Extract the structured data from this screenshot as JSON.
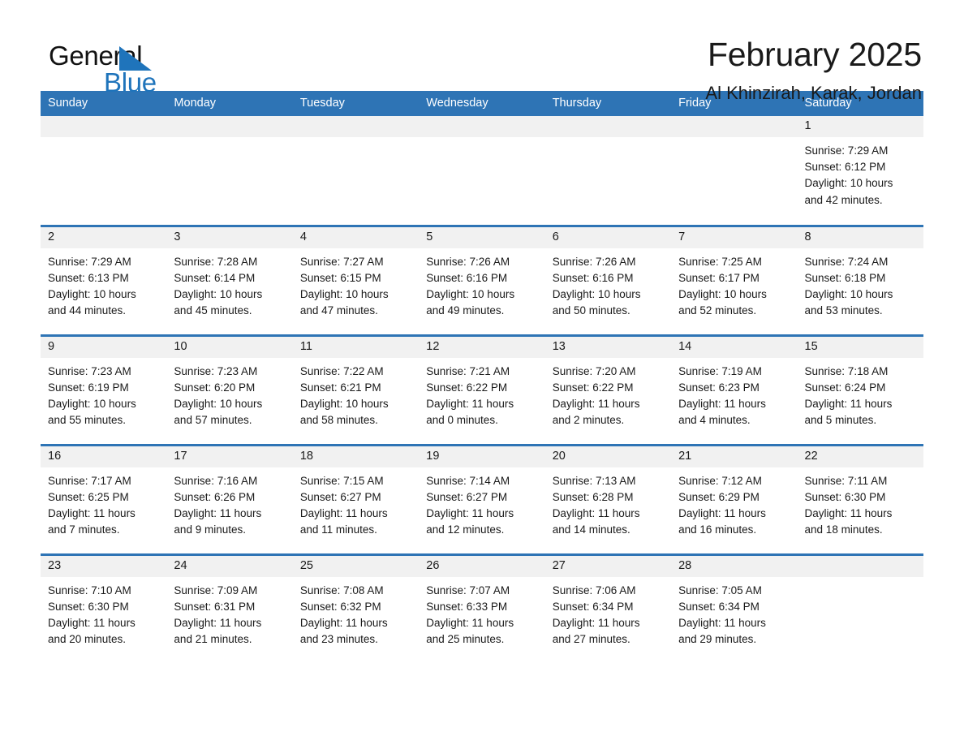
{
  "logo": {
    "text_primary": "General",
    "text_secondary": "Blue",
    "accent_color": "#1f74bb"
  },
  "header": {
    "title": "February 2025",
    "subtitle": "Al Khinzirah, Karak, Jordan",
    "header_bar_color": "#2e74b5",
    "daynum_band_color": "#f1f1f1"
  },
  "weekday_headers": [
    "Sunday",
    "Monday",
    "Tuesday",
    "Wednesday",
    "Thursday",
    "Friday",
    "Saturday"
  ],
  "weeks": [
    [
      {
        "day": "",
        "sunrise": "",
        "sunset": "",
        "daylight_l1": "",
        "daylight_l2": ""
      },
      {
        "day": "",
        "sunrise": "",
        "sunset": "",
        "daylight_l1": "",
        "daylight_l2": ""
      },
      {
        "day": "",
        "sunrise": "",
        "sunset": "",
        "daylight_l1": "",
        "daylight_l2": ""
      },
      {
        "day": "",
        "sunrise": "",
        "sunset": "",
        "daylight_l1": "",
        "daylight_l2": ""
      },
      {
        "day": "",
        "sunrise": "",
        "sunset": "",
        "daylight_l1": "",
        "daylight_l2": ""
      },
      {
        "day": "",
        "sunrise": "",
        "sunset": "",
        "daylight_l1": "",
        "daylight_l2": ""
      },
      {
        "day": "1",
        "sunrise": "Sunrise: 7:29 AM",
        "sunset": "Sunset: 6:12 PM",
        "daylight_l1": "Daylight: 10 hours",
        "daylight_l2": "and 42 minutes."
      }
    ],
    [
      {
        "day": "2",
        "sunrise": "Sunrise: 7:29 AM",
        "sunset": "Sunset: 6:13 PM",
        "daylight_l1": "Daylight: 10 hours",
        "daylight_l2": "and 44 minutes."
      },
      {
        "day": "3",
        "sunrise": "Sunrise: 7:28 AM",
        "sunset": "Sunset: 6:14 PM",
        "daylight_l1": "Daylight: 10 hours",
        "daylight_l2": "and 45 minutes."
      },
      {
        "day": "4",
        "sunrise": "Sunrise: 7:27 AM",
        "sunset": "Sunset: 6:15 PM",
        "daylight_l1": "Daylight: 10 hours",
        "daylight_l2": "and 47 minutes."
      },
      {
        "day": "5",
        "sunrise": "Sunrise: 7:26 AM",
        "sunset": "Sunset: 6:16 PM",
        "daylight_l1": "Daylight: 10 hours",
        "daylight_l2": "and 49 minutes."
      },
      {
        "day": "6",
        "sunrise": "Sunrise: 7:26 AM",
        "sunset": "Sunset: 6:16 PM",
        "daylight_l1": "Daylight: 10 hours",
        "daylight_l2": "and 50 minutes."
      },
      {
        "day": "7",
        "sunrise": "Sunrise: 7:25 AM",
        "sunset": "Sunset: 6:17 PM",
        "daylight_l1": "Daylight: 10 hours",
        "daylight_l2": "and 52 minutes."
      },
      {
        "day": "8",
        "sunrise": "Sunrise: 7:24 AM",
        "sunset": "Sunset: 6:18 PM",
        "daylight_l1": "Daylight: 10 hours",
        "daylight_l2": "and 53 minutes."
      }
    ],
    [
      {
        "day": "9",
        "sunrise": "Sunrise: 7:23 AM",
        "sunset": "Sunset: 6:19 PM",
        "daylight_l1": "Daylight: 10 hours",
        "daylight_l2": "and 55 minutes."
      },
      {
        "day": "10",
        "sunrise": "Sunrise: 7:23 AM",
        "sunset": "Sunset: 6:20 PM",
        "daylight_l1": "Daylight: 10 hours",
        "daylight_l2": "and 57 minutes."
      },
      {
        "day": "11",
        "sunrise": "Sunrise: 7:22 AM",
        "sunset": "Sunset: 6:21 PM",
        "daylight_l1": "Daylight: 10 hours",
        "daylight_l2": "and 58 minutes."
      },
      {
        "day": "12",
        "sunrise": "Sunrise: 7:21 AM",
        "sunset": "Sunset: 6:22 PM",
        "daylight_l1": "Daylight: 11 hours",
        "daylight_l2": "and 0 minutes."
      },
      {
        "day": "13",
        "sunrise": "Sunrise: 7:20 AM",
        "sunset": "Sunset: 6:22 PM",
        "daylight_l1": "Daylight: 11 hours",
        "daylight_l2": "and 2 minutes."
      },
      {
        "day": "14",
        "sunrise": "Sunrise: 7:19 AM",
        "sunset": "Sunset: 6:23 PM",
        "daylight_l1": "Daylight: 11 hours",
        "daylight_l2": "and 4 minutes."
      },
      {
        "day": "15",
        "sunrise": "Sunrise: 7:18 AM",
        "sunset": "Sunset: 6:24 PM",
        "daylight_l1": "Daylight: 11 hours",
        "daylight_l2": "and 5 minutes."
      }
    ],
    [
      {
        "day": "16",
        "sunrise": "Sunrise: 7:17 AM",
        "sunset": "Sunset: 6:25 PM",
        "daylight_l1": "Daylight: 11 hours",
        "daylight_l2": "and 7 minutes."
      },
      {
        "day": "17",
        "sunrise": "Sunrise: 7:16 AM",
        "sunset": "Sunset: 6:26 PM",
        "daylight_l1": "Daylight: 11 hours",
        "daylight_l2": "and 9 minutes."
      },
      {
        "day": "18",
        "sunrise": "Sunrise: 7:15 AM",
        "sunset": "Sunset: 6:27 PM",
        "daylight_l1": "Daylight: 11 hours",
        "daylight_l2": "and 11 minutes."
      },
      {
        "day": "19",
        "sunrise": "Sunrise: 7:14 AM",
        "sunset": "Sunset: 6:27 PM",
        "daylight_l1": "Daylight: 11 hours",
        "daylight_l2": "and 12 minutes."
      },
      {
        "day": "20",
        "sunrise": "Sunrise: 7:13 AM",
        "sunset": "Sunset: 6:28 PM",
        "daylight_l1": "Daylight: 11 hours",
        "daylight_l2": "and 14 minutes."
      },
      {
        "day": "21",
        "sunrise": "Sunrise: 7:12 AM",
        "sunset": "Sunset: 6:29 PM",
        "daylight_l1": "Daylight: 11 hours",
        "daylight_l2": "and 16 minutes."
      },
      {
        "day": "22",
        "sunrise": "Sunrise: 7:11 AM",
        "sunset": "Sunset: 6:30 PM",
        "daylight_l1": "Daylight: 11 hours",
        "daylight_l2": "and 18 minutes."
      }
    ],
    [
      {
        "day": "23",
        "sunrise": "Sunrise: 7:10 AM",
        "sunset": "Sunset: 6:30 PM",
        "daylight_l1": "Daylight: 11 hours",
        "daylight_l2": "and 20 minutes."
      },
      {
        "day": "24",
        "sunrise": "Sunrise: 7:09 AM",
        "sunset": "Sunset: 6:31 PM",
        "daylight_l1": "Daylight: 11 hours",
        "daylight_l2": "and 21 minutes."
      },
      {
        "day": "25",
        "sunrise": "Sunrise: 7:08 AM",
        "sunset": "Sunset: 6:32 PM",
        "daylight_l1": "Daylight: 11 hours",
        "daylight_l2": "and 23 minutes."
      },
      {
        "day": "26",
        "sunrise": "Sunrise: 7:07 AM",
        "sunset": "Sunset: 6:33 PM",
        "daylight_l1": "Daylight: 11 hours",
        "daylight_l2": "and 25 minutes."
      },
      {
        "day": "27",
        "sunrise": "Sunrise: 7:06 AM",
        "sunset": "Sunset: 6:34 PM",
        "daylight_l1": "Daylight: 11 hours",
        "daylight_l2": "and 27 minutes."
      },
      {
        "day": "28",
        "sunrise": "Sunrise: 7:05 AM",
        "sunset": "Sunset: 6:34 PM",
        "daylight_l1": "Daylight: 11 hours",
        "daylight_l2": "and 29 minutes."
      },
      {
        "day": "",
        "sunrise": "",
        "sunset": "",
        "daylight_l1": "",
        "daylight_l2": ""
      }
    ]
  ]
}
